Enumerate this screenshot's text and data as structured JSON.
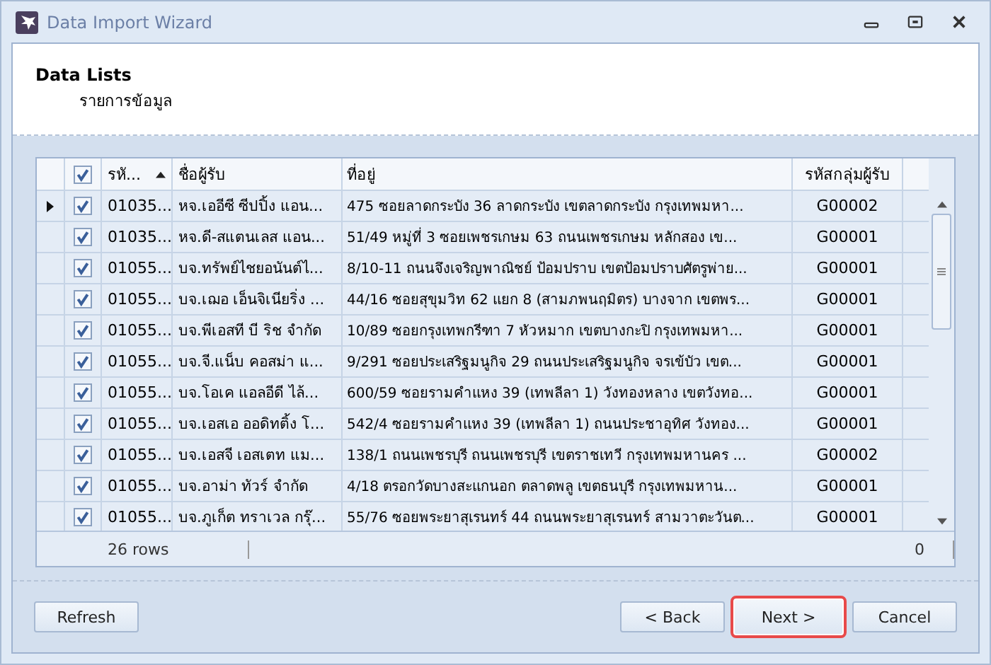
{
  "window": {
    "title": "Data Import Wizard"
  },
  "header": {
    "title": "Data Lists",
    "subtitle": "รายการข้อมูล"
  },
  "table": {
    "all_checked": true,
    "columns": [
      {
        "label": "รหั...",
        "sorted": true
      },
      {
        "label": "ชื่อผู้รับ",
        "sorted": false
      },
      {
        "label": "ที่อยู่",
        "sorted": false
      },
      {
        "label": "รหัสกลุ่มผู้รับ",
        "sorted": false
      }
    ],
    "rows": [
      {
        "selected": true,
        "checked": true,
        "cells": [
          "01035...",
          "หจ.เออีซี ซีปปิ้ง แอน...",
          "475 ซอยลาดกระบัง 36  ลาดกระบัง เขตลาดกระบัง กรุงเทพมหา...",
          "G00002"
        ]
      },
      {
        "selected": false,
        "checked": true,
        "cells": [
          "01035...",
          "หจ.ดี-สแตนเลส แอน...",
          "51/49 หมู่ที่ 3 ซอยเพชรเกษม 63 ถนนเพชรเกษม  หลักสอง เข...",
          "G00001"
        ]
      },
      {
        "selected": false,
        "checked": true,
        "cells": [
          "01055...",
          "บจ.ทรัพย์ไชยอนันต์ไ...",
          "8/10-11 ถนนจึงเจริญพาณิชย์  ป้อมปราบ เขตป้อมปราบศัตรูพ่าย...",
          "G00001"
        ]
      },
      {
        "selected": false,
        "checked": true,
        "cells": [
          "01055...",
          "บจ.เฌอ เอ็นจิเนียริ่ง ...",
          "44/16 ซอยสุขุมวิท 62 แยก 8 (สามภพนฤมิตร)  บางจาก เขตพร...",
          "G00001"
        ]
      },
      {
        "selected": false,
        "checked": true,
        "cells": [
          "01055...",
          "บจ.พีเอสที บี ริช จำกัด",
          "10/89 ซอยกรุงเทพกรีฑา 7  หัวหมาก เขตบางกะปิ กรุงเทพมหา...",
          "G00001"
        ]
      },
      {
        "selected": false,
        "checked": true,
        "cells": [
          "01055...",
          "บจ.จี.แน็บ คอสม่า แ...",
          "9/291 ซอยประเสริฐมนูกิจ 29 ถนนประเสริฐมนูกิจ  จรเข้บัว เขต...",
          "G00001"
        ]
      },
      {
        "selected": false,
        "checked": true,
        "cells": [
          "01055...",
          "บจ.โอเค แอลอีดี ไล้...",
          "600/59 ซอยรามคำแหง 39 (เทพลีลา 1)  วังทองหลาง เขตวังทอ...",
          "G00001"
        ]
      },
      {
        "selected": false,
        "checked": true,
        "cells": [
          "01055...",
          "บจ.เอสเอ ออดิทติ้ง โ...",
          "542/4 ซอยรามคำแหง 39 (เทพลีลา 1) ถนนประชาอุทิศ  วังทอง...",
          "G00001"
        ]
      },
      {
        "selected": false,
        "checked": true,
        "cells": [
          "01055...",
          "บจ.เอสจี เอสเตท แม...",
          "138/1 ถนนเพชรบุรี  ถนนเพชรบุรี เขตราชเทวี กรุงเทพมหานคร ...",
          "G00002"
        ]
      },
      {
        "selected": false,
        "checked": true,
        "cells": [
          "01055...",
          "บจ.อาม่า ทัวร์ จำกัด",
          "4/18 ตรอกวัดบางสะแกนอก  ตลาดพลู เขตธนบุรี กรุงเทพมหาน...",
          "G00001"
        ]
      },
      {
        "selected": false,
        "checked": true,
        "cells": [
          "01055...",
          "บจ.ภูเก็ต ทราเวล กรุ๊...",
          "55/76 ซอยพระยาสุเรนทร์ 44 ถนนพระยาสุเรนทร์  สามวาตะวันต...",
          "G00001"
        ]
      }
    ],
    "footer": {
      "count": "26 rows",
      "total": "0"
    }
  },
  "buttons": [
    {
      "label": "Refresh",
      "highlighted": false
    },
    {
      "label": "< Back",
      "highlighted": false
    },
    {
      "label": "Next >",
      "highlighted": true
    },
    {
      "label": "Cancel",
      "highlighted": false
    }
  ]
}
